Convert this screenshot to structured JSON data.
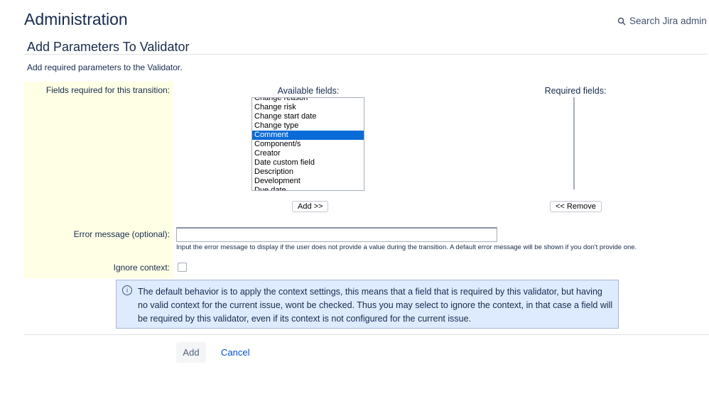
{
  "header": {
    "title": "Administration",
    "search_label": "Search Jira admin"
  },
  "page": {
    "heading": "Add Parameters To Validator",
    "description": "Add required parameters to the Validator."
  },
  "form": {
    "fields_label": "Fields required for this transition:",
    "available_label": "Available fields:",
    "required_label": "Required fields:",
    "available_options": [
      "Change reason",
      "Change risk",
      "Change start date",
      "Change type",
      "Comment",
      "Component/s",
      "Creator",
      "Date custom field",
      "Description",
      "Development",
      "Due date"
    ],
    "selected_option": "Comment",
    "required_options": [],
    "add_field_label": "Add >>",
    "remove_field_label": "<< Remove",
    "error_label": "Error message (optional):",
    "error_value": "",
    "error_help": "Input the error message to display if the user does not provide a value during the transition. A default error message will be shown if you don't provide one.",
    "ignore_label": "Ignore context:",
    "ignore_checked": false
  },
  "info": {
    "text": "The default behavior is to apply the context settings, this means that a field that is required by this validator, but having no valid context for the current issue, wont be checked. Thus you may select to ignore the context, in that case a field will be required by this validator, even if its context is not configured for the current issue."
  },
  "actions": {
    "add_label": "Add",
    "cancel_label": "Cancel"
  },
  "colors": {
    "selection": "#0b6bd6",
    "label_column": "#ffffe6",
    "info_bg": "#deebff",
    "link": "#0052cc"
  }
}
